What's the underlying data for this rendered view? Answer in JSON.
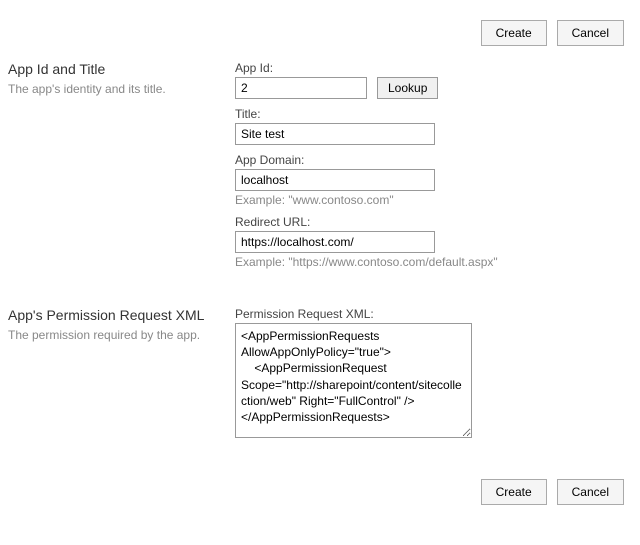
{
  "buttons": {
    "create": "Create",
    "cancel": "Cancel",
    "lookup": "Lookup"
  },
  "section1": {
    "title": "App Id and Title",
    "desc": "The app's identity and its title.",
    "appid": {
      "label": "App Id:",
      "value": "2"
    },
    "titleField": {
      "label": "Title:",
      "value": "Site test"
    },
    "domain": {
      "label": "App Domain:",
      "value": "localhost",
      "hint": "Example: \"www.contoso.com\""
    },
    "redirect": {
      "label": "Redirect URL:",
      "value": "https://localhost.com/",
      "hint": "Example: \"https://www.contoso.com/default.aspx\""
    }
  },
  "section2": {
    "title": "App's Permission Request XML",
    "desc": "The permission required by the app.",
    "xml": {
      "label": "Permission Request XML:",
      "value": "<AppPermissionRequests AllowAppOnlyPolicy=\"true\">\n    <AppPermissionRequest Scope=\"http://sharepoint/content/sitecollection/web\" Right=\"FullControl\" />\n</AppPermissionRequests>"
    }
  }
}
